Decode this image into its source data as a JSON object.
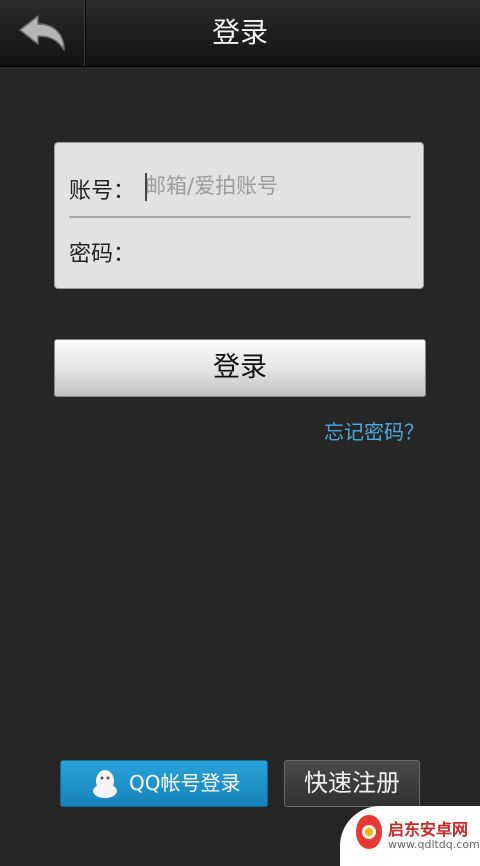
{
  "header": {
    "title": "登录",
    "back_icon": "back-arrow-icon"
  },
  "login_form": {
    "account_label": "账号：",
    "account_placeholder": "邮箱/爱拍账号",
    "password_label": "密码："
  },
  "login_button": "登录",
  "forgot_password": "忘记密码？",
  "qq_login": {
    "label": "QQ帐号登录",
    "icon": "qq-penguin-icon"
  },
  "register_button": "快速注册",
  "watermark": {
    "name": "启东安卓网",
    "url": "www.qdltdq.com"
  },
  "colors": {
    "background": "#262626",
    "link": "#4fa8dc",
    "qq_button": "#1e92c9",
    "watermark_text": "#c62828"
  }
}
